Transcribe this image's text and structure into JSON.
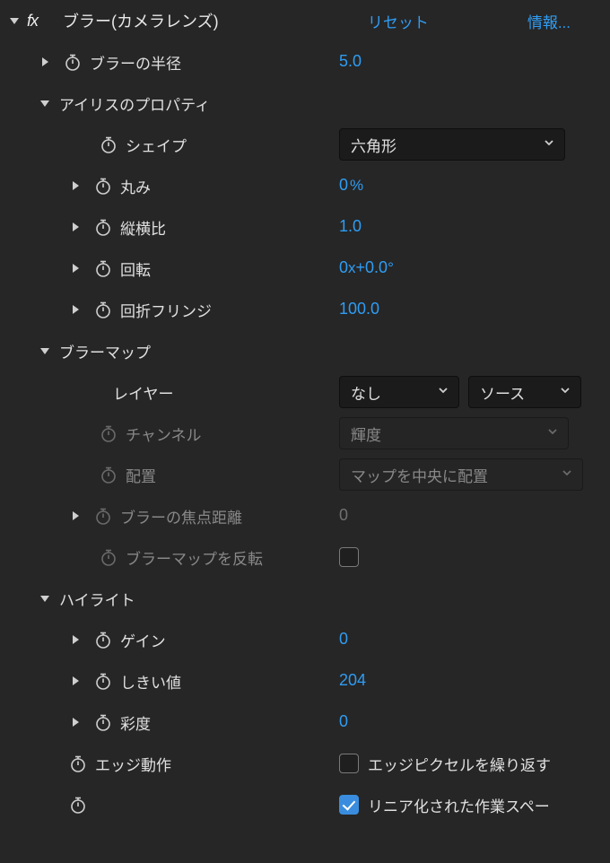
{
  "effect": {
    "title": "ブラー(カメラレンズ)",
    "reset": "リセット",
    "about": "情報..."
  },
  "props": {
    "blur_radius": {
      "label": "ブラーの半径",
      "value": "5.0"
    },
    "iris_group": "アイリスのプロパティ",
    "shape": {
      "label": "シェイプ",
      "value": "六角形"
    },
    "roundness": {
      "label": "丸み",
      "value": "0",
      "unit": "%"
    },
    "aspect": {
      "label": "縦横比",
      "value": "1.0"
    },
    "rotation": {
      "label": "回転",
      "rev": "0",
      "x": "x",
      "deg": "+0.0",
      "degmark": "°"
    },
    "diffraction": {
      "label": "回折フリンジ",
      "value": "100.0"
    },
    "blurmap_group": "ブラーマップ",
    "layer": {
      "label": "レイヤー",
      "value": "なし",
      "source": "ソース"
    },
    "channel": {
      "label": "チャンネル",
      "value": "輝度"
    },
    "placement": {
      "label": "配置",
      "value": "マップを中央に配置"
    },
    "focal": {
      "label": "ブラーの焦点距離",
      "value": "0"
    },
    "invert_map": {
      "label": "ブラーマップを反転"
    },
    "highlight_group": "ハイライト",
    "gain": {
      "label": "ゲイン",
      "value": "0"
    },
    "threshold": {
      "label": "しきい値",
      "value": "204"
    },
    "saturation": {
      "label": "彩度",
      "value": "0"
    },
    "edge": {
      "label": "エッジ動作",
      "check_label": "エッジピクセルを繰り返す"
    },
    "linear": {
      "check_label": "リニア化された作業スペー"
    }
  }
}
